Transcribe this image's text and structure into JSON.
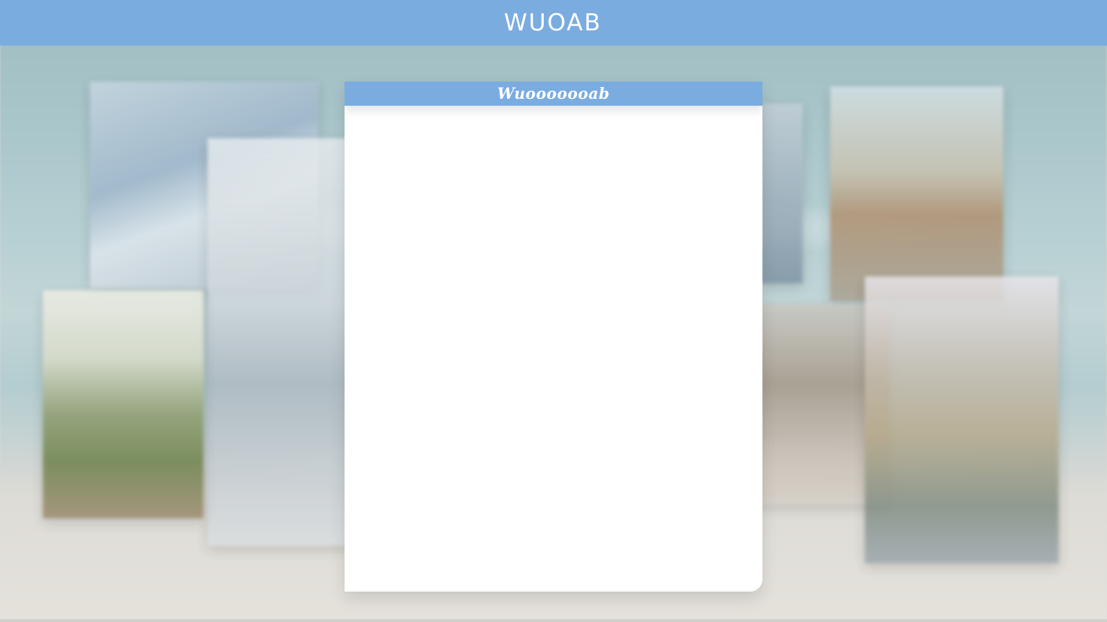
{
  "header": {
    "title": "WUOAB"
  },
  "panel": {
    "title": "Wuooooooab"
  },
  "colors": {
    "accent": "#7aace0",
    "panel_background": "#ffffff",
    "header_text": "#ffffff"
  }
}
